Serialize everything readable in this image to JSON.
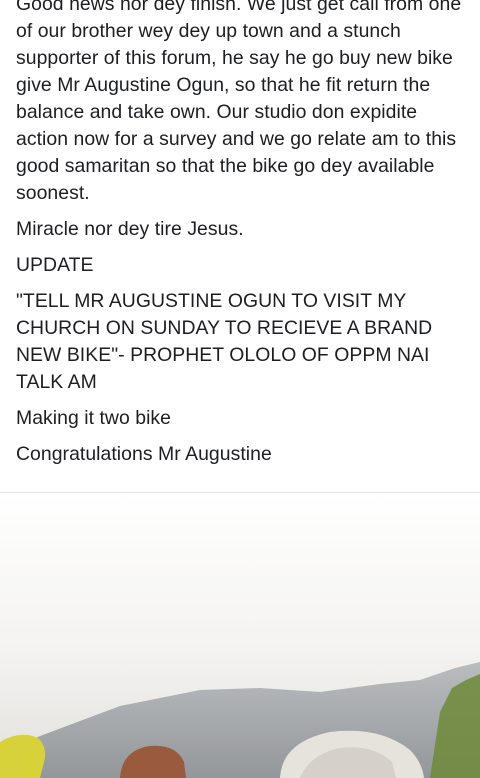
{
  "post": {
    "paragraphs": [
      "Good news nor dey finish. We just get call from one of our brother wey dey up town and a stunch supporter of this forum, he say he go buy new bike give Mr Augustine Ogun, so that he fit return the balance and take own. Our studio don expidite action now for a survey and we go relate am to this good samaritan so that the bike go dey available soonest.",
      "Miracle nor dey tire Jesus.",
      "UPDATE",
      "\"TELL MR AUGUSTINE OGUN TO VISIT MY CHURCH ON SUNDAY TO RECIEVE A BRAND NEW BIKE\"- PROPHET OLOLO OF OPPM NAI TALK AM",
      "Making it two bike",
      "Congratulations Mr Augustine"
    ]
  },
  "photo": {
    "colors": {
      "background": "#ffffff",
      "haze": "#e9e8e6",
      "roof": "#8a8f94",
      "foliage": "#6f8a3a",
      "helmet_yellow": "#d8d23a",
      "skin": "#9a5a3e",
      "helmet_white": "#e6e2dc"
    }
  }
}
